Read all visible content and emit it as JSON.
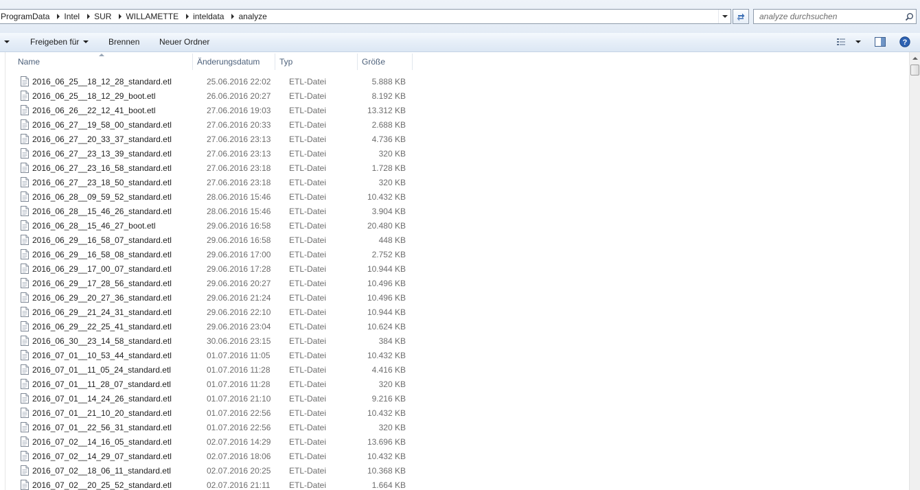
{
  "address_bar": {
    "crumbs": [
      "ProgramData",
      "Intel",
      "SUR",
      "WILLAMETTE",
      "inteldata",
      "analyze"
    ]
  },
  "search": {
    "placeholder": "analyze durchsuchen"
  },
  "toolbar": {
    "share_label": "Freigeben für",
    "burn_label": "Brennen",
    "new_folder_label": "Neuer Ordner"
  },
  "columns": {
    "name": "Name",
    "date": "Änderungsdatum",
    "type": "Typ",
    "size": "Größe"
  },
  "files": [
    {
      "name": "2016_06_25__18_12_28_standard.etl",
      "date": "25.06.2016 22:02",
      "type": "ETL-Datei",
      "size": "5.888 KB"
    },
    {
      "name": "2016_06_25__18_12_29_boot.etl",
      "date": "26.06.2016 20:27",
      "type": "ETL-Datei",
      "size": "8.192 KB"
    },
    {
      "name": "2016_06_26__22_12_41_boot.etl",
      "date": "27.06.2016 19:03",
      "type": "ETL-Datei",
      "size": "13.312 KB"
    },
    {
      "name": "2016_06_27__19_58_00_standard.etl",
      "date": "27.06.2016 20:33",
      "type": "ETL-Datei",
      "size": "2.688 KB"
    },
    {
      "name": "2016_06_27__20_33_37_standard.etl",
      "date": "27.06.2016 23:13",
      "type": "ETL-Datei",
      "size": "4.736 KB"
    },
    {
      "name": "2016_06_27__23_13_39_standard.etl",
      "date": "27.06.2016 23:13",
      "type": "ETL-Datei",
      "size": "320 KB"
    },
    {
      "name": "2016_06_27__23_16_58_standard.etl",
      "date": "27.06.2016 23:18",
      "type": "ETL-Datei",
      "size": "1.728 KB"
    },
    {
      "name": "2016_06_27__23_18_50_standard.etl",
      "date": "27.06.2016 23:18",
      "type": "ETL-Datei",
      "size": "320 KB"
    },
    {
      "name": "2016_06_28__09_59_52_standard.etl",
      "date": "28.06.2016 15:46",
      "type": "ETL-Datei",
      "size": "10.432 KB"
    },
    {
      "name": "2016_06_28__15_46_26_standard.etl",
      "date": "28.06.2016 15:46",
      "type": "ETL-Datei",
      "size": "3.904 KB"
    },
    {
      "name": "2016_06_28__15_46_27_boot.etl",
      "date": "29.06.2016 16:58",
      "type": "ETL-Datei",
      "size": "20.480 KB"
    },
    {
      "name": "2016_06_29__16_58_07_standard.etl",
      "date": "29.06.2016 16:58",
      "type": "ETL-Datei",
      "size": "448 KB"
    },
    {
      "name": "2016_06_29__16_58_08_standard.etl",
      "date": "29.06.2016 17:00",
      "type": "ETL-Datei",
      "size": "2.752 KB"
    },
    {
      "name": "2016_06_29__17_00_07_standard.etl",
      "date": "29.06.2016 17:28",
      "type": "ETL-Datei",
      "size": "10.944 KB"
    },
    {
      "name": "2016_06_29__17_28_56_standard.etl",
      "date": "29.06.2016 20:27",
      "type": "ETL-Datei",
      "size": "10.496 KB"
    },
    {
      "name": "2016_06_29__20_27_36_standard.etl",
      "date": "29.06.2016 21:24",
      "type": "ETL-Datei",
      "size": "10.496 KB"
    },
    {
      "name": "2016_06_29__21_24_31_standard.etl",
      "date": "29.06.2016 22:10",
      "type": "ETL-Datei",
      "size": "10.944 KB"
    },
    {
      "name": "2016_06_29__22_25_41_standard.etl",
      "date": "29.06.2016 23:04",
      "type": "ETL-Datei",
      "size": "10.624 KB"
    },
    {
      "name": "2016_06_30__23_14_58_standard.etl",
      "date": "30.06.2016 23:15",
      "type": "ETL-Datei",
      "size": "384 KB"
    },
    {
      "name": "2016_07_01__10_53_44_standard.etl",
      "date": "01.07.2016 11:05",
      "type": "ETL-Datei",
      "size": "10.432 KB"
    },
    {
      "name": "2016_07_01__11_05_24_standard.etl",
      "date": "01.07.2016 11:28",
      "type": "ETL-Datei",
      "size": "4.416 KB"
    },
    {
      "name": "2016_07_01__11_28_07_standard.etl",
      "date": "01.07.2016 11:28",
      "type": "ETL-Datei",
      "size": "320 KB"
    },
    {
      "name": "2016_07_01__14_24_26_standard.etl",
      "date": "01.07.2016 21:10",
      "type": "ETL-Datei",
      "size": "9.216 KB"
    },
    {
      "name": "2016_07_01__21_10_20_standard.etl",
      "date": "01.07.2016 22:56",
      "type": "ETL-Datei",
      "size": "10.432 KB"
    },
    {
      "name": "2016_07_01__22_56_31_standard.etl",
      "date": "01.07.2016 22:56",
      "type": "ETL-Datei",
      "size": "320 KB"
    },
    {
      "name": "2016_07_02__14_16_05_standard.etl",
      "date": "02.07.2016 14:29",
      "type": "ETL-Datei",
      "size": "13.696 KB"
    },
    {
      "name": "2016_07_02__14_29_07_standard.etl",
      "date": "02.07.2016 18:06",
      "type": "ETL-Datei",
      "size": "10.432 KB"
    },
    {
      "name": "2016_07_02__18_06_11_standard.etl",
      "date": "02.07.2016 20:25",
      "type": "ETL-Datei",
      "size": "10.368 KB"
    },
    {
      "name": "2016_07_02__20_25_52_standard.etl",
      "date": "02.07.2016 21:11",
      "type": "ETL-Datei",
      "size": "1.664 KB"
    }
  ]
}
